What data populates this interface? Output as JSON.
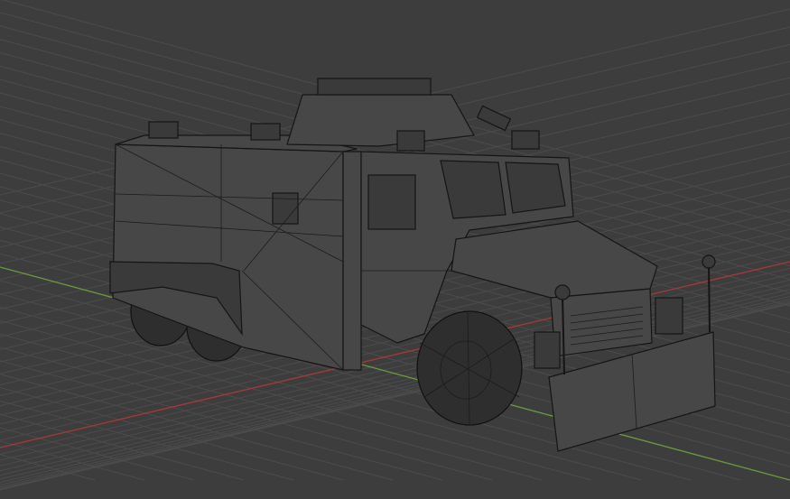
{
  "viewport": {
    "background_color": "#3d3d3d",
    "grid_color": "#4b4b4b",
    "x_axis_color": "#a83838",
    "y_axis_color": "#6c9a3c",
    "mesh_face_color": "#474747",
    "mesh_edge_color": "#151515"
  }
}
